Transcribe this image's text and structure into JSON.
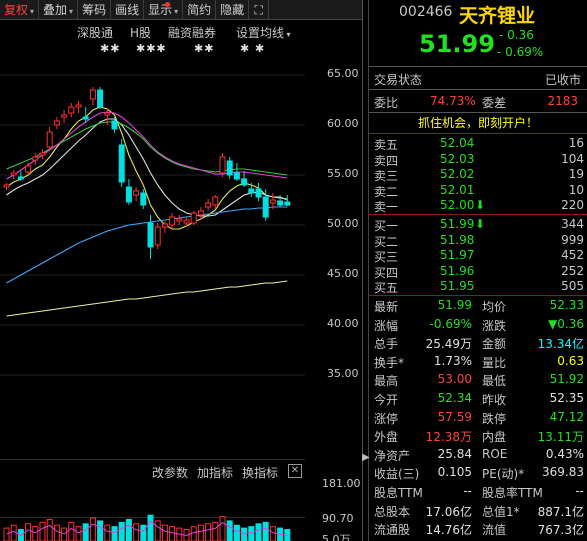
{
  "toolbar": {
    "items": [
      {
        "label": "复权",
        "dropdown": true,
        "active": true
      },
      {
        "label": "叠加",
        "dropdown": true
      },
      {
        "label": "筹码"
      },
      {
        "label": "画线"
      },
      {
        "label": "显示",
        "dropdown": true,
        "dot": true
      },
      {
        "label": "简约"
      },
      {
        "label": "隐藏"
      }
    ],
    "close_icon": "expand-icon"
  },
  "subtoolbar": {
    "items": [
      "深股通",
      "H股",
      "融资融券",
      "设置均线"
    ],
    "marks": [
      "✱✱",
      "✱✱✱",
      "✱✱",
      "✱  ✱"
    ]
  },
  "price_axis": [
    "65.00",
    "60.00",
    "55.00",
    "50.00",
    "45.00",
    "40.00",
    "35.00"
  ],
  "volume_axis": [
    "181.00",
    "90.70",
    "5.0万"
  ],
  "indicator_bar": {
    "buttons": [
      "改参数",
      "加指标",
      "换指标"
    ],
    "close": "✕"
  },
  "quote": {
    "code": "002466",
    "name": "天齐锂业",
    "price": "51.99",
    "change": "- 0.36",
    "change_pct": "- 0.69%",
    "trade_status_label": "交易状态",
    "trade_status": "已收市",
    "weibi_label": "委比",
    "weibi": "74.73%",
    "weicha_label": "委差",
    "weicha": "2183",
    "promo": "抓住机会，即刻开户！"
  },
  "order_book": {
    "sell": [
      {
        "label": "卖五",
        "price": "52.04",
        "vol": "16",
        "arrow": ""
      },
      {
        "label": "卖四",
        "price": "52.03",
        "vol": "104",
        "arrow": ""
      },
      {
        "label": "卖三",
        "price": "52.02",
        "vol": "19",
        "arrow": ""
      },
      {
        "label": "卖二",
        "price": "52.01",
        "vol": "10",
        "arrow": ""
      },
      {
        "label": "卖一",
        "price": "52.00",
        "vol": "220",
        "arrow": "⬇"
      }
    ],
    "buy": [
      {
        "label": "买一",
        "price": "51.99",
        "vol": "344",
        "arrow": "⬇"
      },
      {
        "label": "买二",
        "price": "51.98",
        "vol": "999",
        "arrow": ""
      },
      {
        "label": "买三",
        "price": "51.97",
        "vol": "452",
        "arrow": ""
      },
      {
        "label": "买四",
        "price": "51.96",
        "vol": "252",
        "arrow": ""
      },
      {
        "label": "买五",
        "price": "51.95",
        "vol": "505",
        "arrow": ""
      }
    ]
  },
  "stats": [
    {
      "l1": "最新",
      "v1": "51.99",
      "c1": "green",
      "l2": "均价",
      "v2": "52.33",
      "c2": "green"
    },
    {
      "l1": "涨幅",
      "v1": "-0.69%",
      "c1": "green",
      "l2": "涨跌",
      "v2": "▼0.36",
      "c2": "green"
    },
    {
      "l1": "总手",
      "v1": "25.49万",
      "c1": "white",
      "l2": "金额",
      "v2": "13.34亿",
      "c2": "cyan"
    },
    {
      "l1": "换手*",
      "v1": "1.73%",
      "c1": "white",
      "l2": "量比",
      "v2": "0.63",
      "c2": "yellow"
    },
    {
      "l1": "最高",
      "v1": "53.00",
      "c1": "red",
      "l2": "最低",
      "v2": "51.92",
      "c2": "green"
    },
    {
      "l1": "今开",
      "v1": "52.34",
      "c1": "green",
      "l2": "昨收",
      "v2": "52.35",
      "c2": "white"
    },
    {
      "l1": "涨停",
      "v1": "57.59",
      "c1": "red",
      "l2": "跌停",
      "v2": "47.12",
      "c2": "green"
    },
    {
      "l1": "外盘",
      "v1": "12.38万",
      "c1": "red",
      "l2": "内盘",
      "v2": "13.11万",
      "c2": "green"
    },
    {
      "l1": "净资产",
      "v1": "25.84",
      "c1": "white",
      "l2": "ROE",
      "v2": "0.43%",
      "c2": "white"
    },
    {
      "l1": "收益(三)",
      "v1": "0.105",
      "c1": "white",
      "l2": "PE(动)*",
      "v2": "369.83",
      "c2": "white"
    },
    {
      "l1": "股息TTM",
      "v1": "--",
      "c1": "white",
      "l2": "股息率TTM",
      "v2": "--",
      "c2": "white"
    },
    {
      "l1": "总股本",
      "v1": "17.06亿",
      "c1": "white",
      "l2": "总值1*",
      "v2": "887.1亿",
      "c2": "white"
    },
    {
      "l1": "流通股",
      "v1": "14.76亿",
      "c1": "white",
      "l2": "流值",
      "v2": "767.3亿",
      "c2": "white"
    }
  ],
  "chart_data": {
    "type": "candlestick",
    "ylim": [
      35,
      65
    ],
    "candles": [
      [
        53.8,
        54.2,
        53.5,
        54.0
      ],
      [
        55.0,
        55.5,
        54.6,
        55.2
      ],
      [
        54.8,
        55.4,
        54.4,
        54.6
      ],
      [
        55.3,
        56.2,
        55.0,
        55.9
      ],
      [
        56.5,
        57.2,
        56.0,
        56.8
      ],
      [
        57.0,
        57.6,
        56.6,
        57.2
      ],
      [
        57.8,
        59.8,
        57.4,
        59.3
      ],
      [
        60.0,
        60.8,
        59.6,
        60.4
      ],
      [
        60.8,
        61.5,
        60.2,
        61.0
      ],
      [
        61.2,
        62.2,
        60.8,
        61.8
      ],
      [
        61.8,
        62.4,
        61.2,
        62.0
      ],
      [
        60.8,
        61.8,
        60.2,
        60.6
      ],
      [
        62.6,
        63.8,
        62.0,
        63.5
      ],
      [
        63.5,
        63.8,
        61.6,
        61.8
      ],
      [
        61.0,
        61.6,
        60.0,
        61.2
      ],
      [
        60.4,
        60.8,
        59.2,
        59.6
      ],
      [
        58.0,
        58.6,
        53.8,
        54.3
      ],
      [
        53.8,
        54.6,
        52.0,
        52.3
      ],
      [
        53.0,
        53.8,
        52.4,
        53.4
      ],
      [
        53.2,
        53.6,
        51.6,
        52.0
      ],
      [
        50.2,
        51.0,
        46.6,
        47.8
      ],
      [
        48.0,
        50.2,
        47.6,
        49.8
      ],
      [
        49.8,
        50.4,
        49.2,
        50.1
      ],
      [
        50.0,
        51.2,
        49.6,
        50.8
      ],
      [
        50.4,
        51.0,
        50.0,
        50.6
      ],
      [
        50.2,
        50.8,
        49.8,
        50.5
      ],
      [
        50.2,
        51.4,
        50.0,
        51.2
      ],
      [
        51.0,
        51.8,
        50.6,
        51.4
      ],
      [
        51.8,
        52.6,
        51.4,
        52.2
      ],
      [
        52.0,
        53.0,
        51.6,
        52.8
      ],
      [
        55.2,
        57.2,
        54.8,
        56.8
      ],
      [
        56.4,
        56.8,
        54.6,
        55.0
      ],
      [
        55.2,
        56.2,
        54.4,
        54.6
      ],
      [
        54.6,
        55.4,
        53.8,
        54.0
      ],
      [
        53.6,
        54.2,
        52.8,
        53.2
      ],
      [
        53.6,
        54.2,
        52.4,
        52.8
      ],
      [
        52.8,
        53.6,
        50.4,
        50.8
      ],
      [
        52.2,
        53.2,
        51.6,
        52.5
      ],
      [
        52.4,
        53.0,
        51.8,
        52.0
      ],
      [
        52.3,
        53.0,
        51.9,
        51.99
      ]
    ],
    "ma_lines": {
      "yellow": [
        53.8,
        54.3,
        54.6,
        55.0,
        55.6,
        56.0,
        56.8,
        57.8,
        58.6,
        59.6,
        60.4,
        60.8,
        61.5,
        61.8,
        61.6,
        61.0,
        59.2,
        57.0,
        55.4,
        54.0,
        52.0,
        50.8,
        50.0,
        49.6,
        49.6,
        49.9,
        50.3,
        50.6,
        51.0,
        51.5,
        52.6,
        53.4,
        53.9,
        54.2,
        54.0,
        53.7,
        53.0,
        52.8,
        52.8,
        52.5
      ],
      "white": [
        53.0,
        53.5,
        53.9,
        54.2,
        54.6,
        55.0,
        55.6,
        56.3,
        57.0,
        57.7,
        58.4,
        59.0,
        59.7,
        60.3,
        60.6,
        60.6,
        60.0,
        59.0,
        57.8,
        56.6,
        55.2,
        54.0,
        53.0,
        52.2,
        51.6,
        51.2,
        51.0,
        50.9,
        50.9,
        51.0,
        51.5,
        52.0,
        52.5,
        53.0,
        53.2,
        53.3,
        53.0,
        52.8,
        52.7,
        52.6
      ],
      "green": [
        55.6,
        55.9,
        56.2,
        56.5,
        56.8,
        57.2,
        57.6,
        58.0,
        58.4,
        58.8,
        59.2,
        59.6,
        59.9,
        60.2,
        60.3,
        60.3,
        60.1,
        59.7,
        59.2,
        58.6,
        57.8,
        57.2,
        56.7,
        56.3,
        56.0,
        55.8,
        55.6,
        55.5,
        55.4,
        55.3,
        55.4,
        55.5,
        55.6,
        55.6,
        55.5,
        55.4,
        55.3,
        55.2,
        55.1,
        55.0
      ],
      "magenta": [
        54.6,
        55.0,
        55.5,
        56.0,
        56.5,
        57.0,
        57.5,
        58.0,
        58.6,
        59.2,
        59.8,
        60.3,
        60.8,
        61.2,
        61.3,
        61.2,
        60.8,
        60.2,
        59.5,
        58.8,
        58.0,
        57.3,
        56.8,
        56.4,
        56.1,
        55.9,
        55.7,
        55.5,
        55.3,
        55.1,
        55.1,
        55.2,
        55.3,
        55.3,
        55.2,
        55.1,
        55.0,
        54.9,
        54.8,
        54.7
      ],
      "cyan": [
        44.2,
        44.6,
        45.0,
        45.4,
        45.8,
        46.2,
        46.6,
        47.0,
        47.4,
        47.8,
        48.2,
        48.5,
        48.8,
        49.1,
        49.4,
        49.6,
        49.8,
        50.0,
        50.1,
        50.2,
        50.3,
        50.4,
        50.5,
        50.6,
        50.7,
        50.8,
        50.9,
        51.0,
        51.1,
        51.2,
        51.3,
        51.4,
        51.5,
        51.6,
        51.6,
        51.7,
        51.7,
        51.8,
        51.8,
        51.8
      ],
      "lime": [
        40.9,
        41.0,
        41.1,
        41.2,
        41.3,
        41.4,
        41.5,
        41.6,
        41.7,
        41.8,
        41.9,
        42.0,
        42.1,
        42.2,
        42.3,
        42.4,
        42.5,
        42.6,
        42.6,
        42.7,
        42.8,
        42.9,
        43.0,
        43.1,
        43.2,
        43.3,
        43.3,
        43.4,
        43.5,
        43.6,
        43.7,
        43.8,
        43.8,
        43.9,
        44.0,
        44.1,
        44.2,
        44.2,
        44.3,
        44.4
      ]
    },
    "volume_ylim": [
      0,
      181
    ],
    "volumes": [
      18,
      22,
      16,
      24,
      20,
      26,
      30,
      22,
      18,
      26,
      20,
      24,
      32,
      28,
      22,
      20,
      26,
      30,
      24,
      22,
      36,
      28,
      22,
      20,
      18,
      16,
      20,
      22,
      24,
      26,
      34,
      28,
      22,
      18,
      20,
      24,
      26,
      20,
      18,
      16
    ]
  }
}
